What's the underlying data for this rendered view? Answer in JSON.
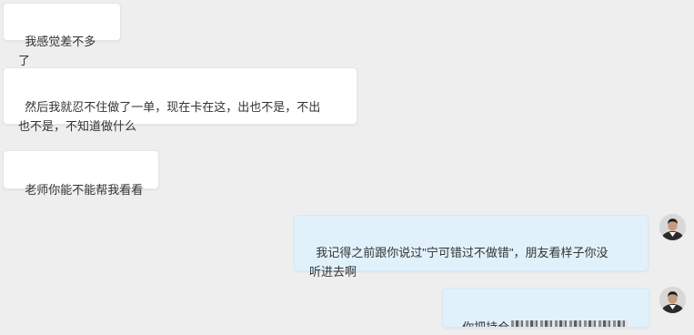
{
  "messages": [
    {
      "side": "incoming",
      "text": "我感觉差不多了"
    },
    {
      "side": "incoming",
      "text": "然后我就忍不住做了一单，现在卡在这，出也不是，不出\n也不是，不知道做什么"
    },
    {
      "side": "incoming",
      "text": "老师你能不能帮我看看"
    },
    {
      "side": "outgoing",
      "text": "我记得之前跟你说过\"宁可错过不做错\"，朋友看样子你没\n听进去啊"
    },
    {
      "side": "outgoing",
      "text": "你把持仓"
    }
  ],
  "colors": {
    "background": "#eeeeee",
    "incoming_bubble": "#ffffff",
    "outgoing_bubble": "#e1f1fb",
    "text": "#333333"
  },
  "icons": {
    "avatar": "user-avatar-photo",
    "redaction": "blurred-mosaic"
  }
}
